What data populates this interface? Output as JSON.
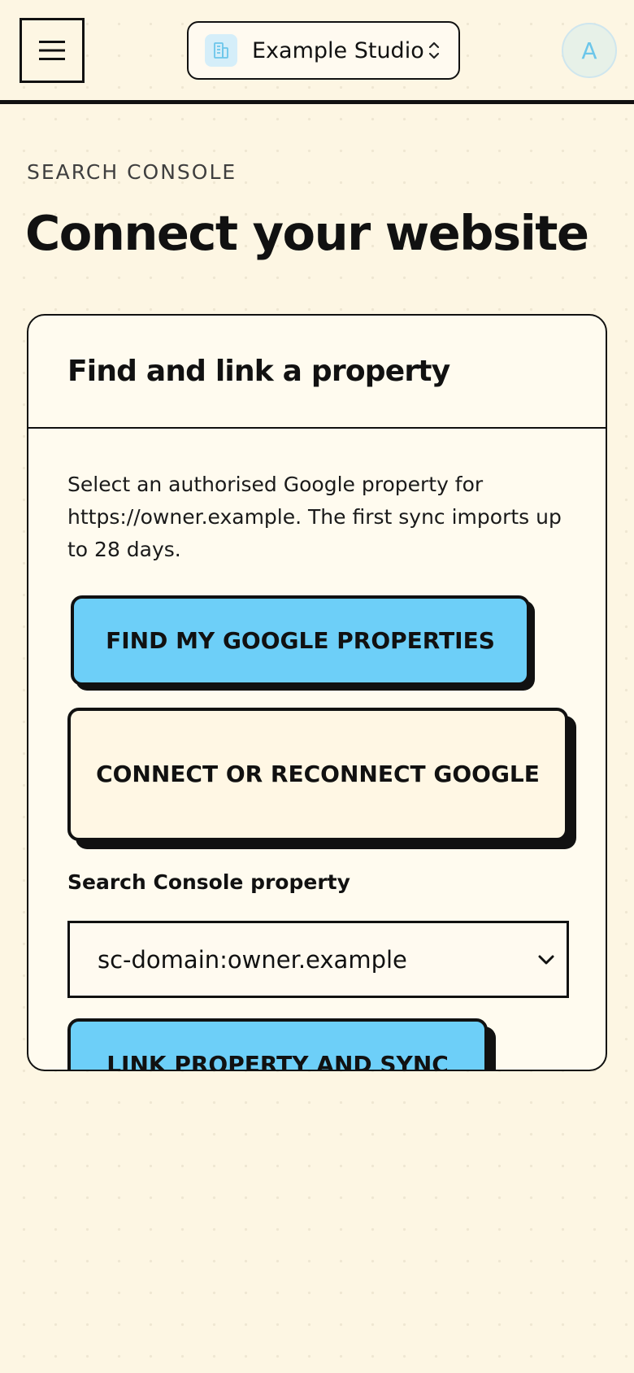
{
  "header": {
    "org_name": "Example Studio",
    "avatar_initial": "A",
    "menu_icon": "hamburger-menu-icon",
    "org_icon": "building-icon",
    "switcher_icon": "chevron-up-down-icon"
  },
  "page": {
    "eyebrow": "SEARCH CONSOLE",
    "title": "Connect your website"
  },
  "card": {
    "title": "Find and link a property",
    "description": "Select an authorised Google property for https://owner.example. The first sync imports up to 28 days.",
    "find_button": "FIND MY GOOGLE PROPERTIES",
    "connect_button": "CONNECT OR RECONNECT GOOGLE",
    "property_label": "Search Console property",
    "property_selected": "sc-domain:owner.example",
    "link_button": "LINK PROPERTY AND SYNC"
  },
  "colors": {
    "background": "#fdf6e3",
    "primary_button": "#6dcff8",
    "border": "#111111",
    "avatar_text": "#6cc6ea"
  }
}
